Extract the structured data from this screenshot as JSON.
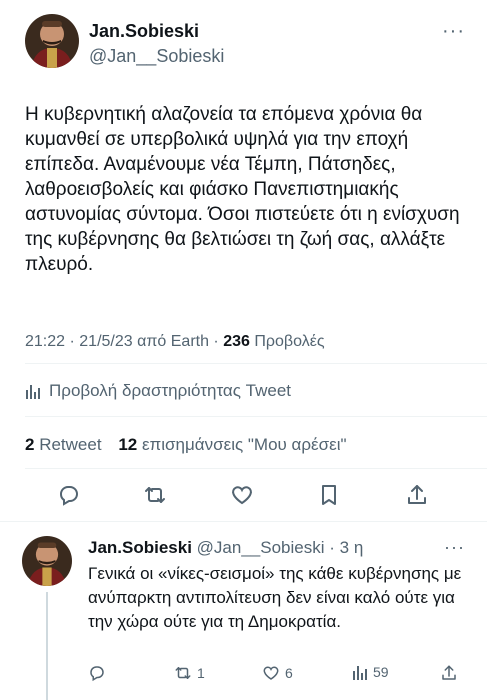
{
  "main": {
    "author_name": "Jan.Sobieski",
    "author_handle": "@Jan__Sobieski",
    "text": "Η κυβερνητική αλαζονεία τα επόμενα χρόνια θα κυμανθεί σε υπερβολικά υψηλά για την εποχή επίπεδα. Αναμένουμε νέα Τέμπη, Πάτσηδες, λαθροεισβολείς και φιάσκο Πανεπιστημιακής αστυνομίας σύντομα. Όσοι πιστεύετε ότι η ενίσχυση της κυβέρνησης θα βελτιώσει τη ζωή σας, αλλάξτε πλευρό.",
    "time": "21:22",
    "date": "21/5/23",
    "source": "από Earth",
    "views_count": "236",
    "views_label": "Προβολές",
    "activity_label": "Προβολή δραστηριότητας Tweet",
    "retweet_count": "2",
    "retweet_label": "Retweet",
    "likes_count": "12",
    "likes_label": "επισημάνσεις \"Μου αρέσει\""
  },
  "reply": {
    "author_name": "Jan.Sobieski",
    "author_handle": "@Jan__Sobieski",
    "age": "3 η",
    "text": "Γενικά οι «νίκες-σεισμοί» της κάθε κυβέρνησης με ανύπαρκτη αντιπολίτευση δεν είναι καλό ούτε για την χώρα ούτε για τη Δημοκρατία.",
    "retweets": "1",
    "likes": "6",
    "views": "59"
  },
  "icons": {
    "more": "more-dots-icon",
    "reply": "reply-bubble-icon",
    "retweet": "retweet-icon",
    "like": "heart-icon",
    "bookmark": "bookmark-icon",
    "share": "share-upload-icon",
    "analytics": "analytics-bars-icon"
  },
  "colors": {
    "text": "#0f1419",
    "secondary": "#536471",
    "divider": "#eff3f4"
  }
}
